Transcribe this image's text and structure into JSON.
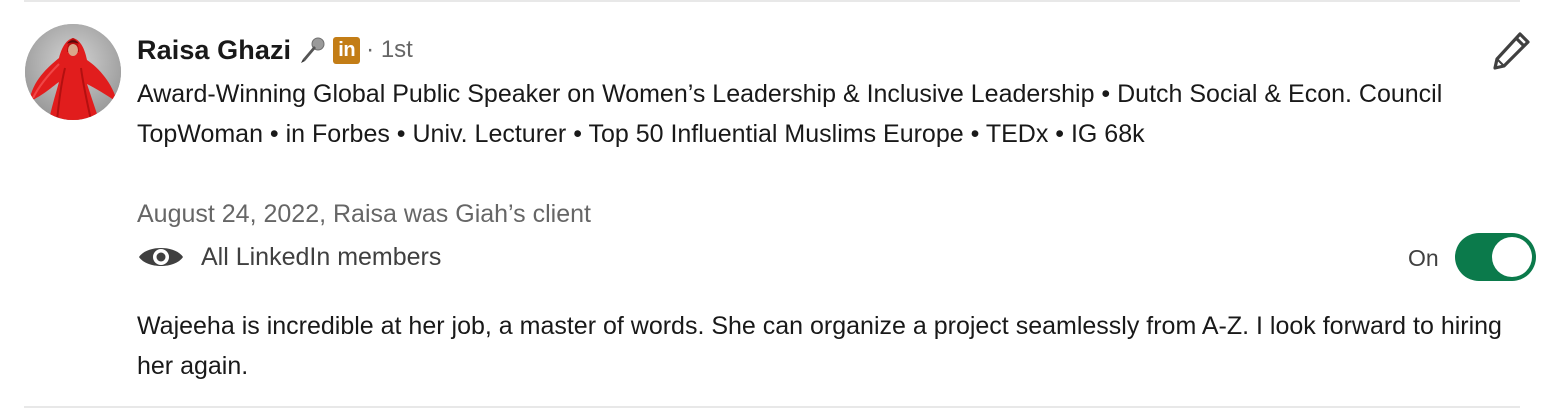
{
  "recommendation": {
    "author_name": "Raisa Ghazi",
    "connection_degree": "· 1st",
    "linkedin_badge": "in",
    "headline": "Award-Winning Global Public Speaker on Women’s Leadership & Inclusive Leadership • Dutch Social & Econ. Council TopWoman • in Forbes • Univ. Lecturer • Top 50 Influential Muslims Europe • TEDx • IG 68k",
    "meta": "August 24, 2022, Raisa was Giah’s client",
    "visibility_label": "All LinkedIn members",
    "toggle_state_label": "On",
    "toggle_on": true,
    "text": "Wajeeha is incredible at her job, a master of words. She can organize a project seamlessly from A-Z. I look forward to hiring her again."
  },
  "icons": {
    "mic": "microphone-icon",
    "linkedin": "linkedin-badge-icon",
    "edit": "pencil-icon",
    "visibility": "eye-icon"
  },
  "colors": {
    "toggle_on": "#0b7a4b",
    "linkedin_badge": "#c37d16",
    "secondary_text": "#666666",
    "primary_text": "#191919"
  }
}
